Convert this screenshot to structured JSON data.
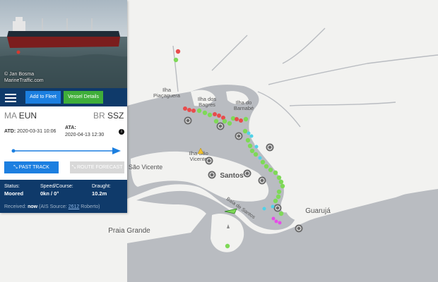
{
  "map": {
    "labels": {
      "ilha_piacaguera": "Ilha\nPiaçaguera",
      "ilha_bagres": "Ilha dos\nBagres",
      "ilha_barnabe": "Ilha do\nBarnabé",
      "ilha_sao_vicente": "Ilha São\nVicente",
      "sao_vicente": "São Vicente",
      "santos": "Santos",
      "baia_de_santos": "Baía de Santos",
      "guaruja": "Guarujá",
      "praia_grande": "Praia Grande"
    },
    "colors": {
      "land": "#f2f2f0",
      "water": "#b9bcc1",
      "cargo_vessel": "#7ed957",
      "tanker_vessel": "#e84c4c",
      "tug_vessel": "#4fd2e8",
      "other_vessel": "#e64ce8",
      "port_icon": "#6b6b6b"
    }
  },
  "vessel_panel": {
    "photo_credit": "© Jan Bosma\nMarineTraffic.com",
    "menu_icon": "hamburger-icon",
    "add_to_fleet": "Add to Fleet",
    "vessel_details": "Vessel Details",
    "departure": {
      "country": "MA",
      "port": "EUN"
    },
    "arrival": {
      "country": "BR",
      "port": "SSZ"
    },
    "atd_label": "ATD:",
    "atd_value": "2020-03-31 10:06",
    "ata_label": "ATA:",
    "ata_value": "2020-04-13 12:30",
    "info_icon": "i",
    "voyage_progress": 1.0,
    "past_track": "PAST TRACK",
    "route_forecast": "ROUTE FORECAST",
    "status_label": "Status:",
    "status_value": "Moored",
    "speed_label": "Speed/Course:",
    "speed_value": "0kn / 0°",
    "draught_label": "Draught:",
    "draught_value": "10.2m",
    "received_label": "Received:",
    "received_value": "now",
    "ais_prefix": "(AIS Source:",
    "ais_source_id": "2612",
    "ais_suffix": "Roberto)"
  }
}
